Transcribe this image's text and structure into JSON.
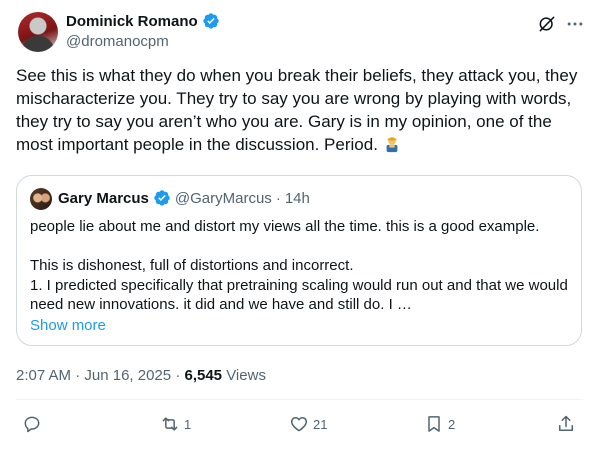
{
  "author": {
    "display_name": "Dominick Romano",
    "handle": "@dromanocpm",
    "verified": true
  },
  "icons": {
    "grok": "grok-icon",
    "more": "more-icon",
    "verified": "verified-badge-icon",
    "emoji": "farmer-emoji"
  },
  "tweet": {
    "text": "See this is what they do when you break their beliefs, they attack you, they mischaracterize you. They try to say you are wrong by playing with words, they try to say you aren’t who you are. Gary is in my opinion, one of the most important people in the discussion. Period."
  },
  "quote": {
    "display_name": "Gary Marcus",
    "handle": "@GaryMarcus",
    "separator": "·",
    "time": "14h",
    "line1": "people lie about me and distort my views all the time. this is a good example.",
    "line2": "This is dishonest, full of distortions and incorrect.",
    "line3": "1. I predicted specifically that pretraining scaling would run out and that we would need new innovations. it did and we have and still do. I …",
    "show_more": "Show more"
  },
  "meta": {
    "time": "2:07 AM",
    "separator1": "·",
    "date": "Jun 16, 2025",
    "separator2": "·",
    "views_count": "6,545",
    "views_label": "Views"
  },
  "actions": {
    "reply_count": "",
    "repost_count": "1",
    "like_count": "21",
    "bookmark_count": "2"
  },
  "colors": {
    "text_primary": "#0f1419",
    "text_secondary": "#536471",
    "link": "#1d9bf0",
    "verified": "#1d9bf0",
    "border": "#cfd9de"
  }
}
